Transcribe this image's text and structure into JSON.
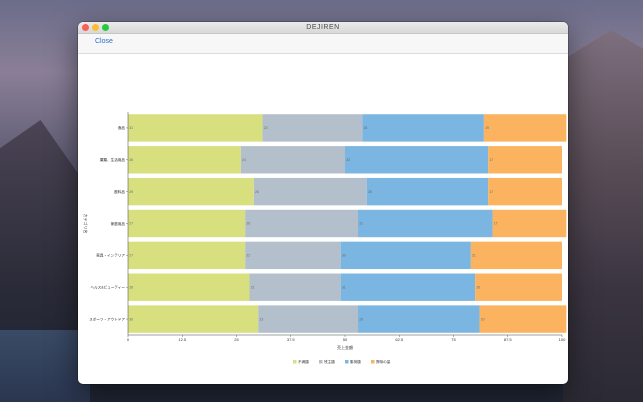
{
  "window": {
    "title": "DEJIREN"
  },
  "toolbar": {
    "close_label": "Close"
  },
  "chart_data": {
    "type": "bar",
    "orientation": "horizontal",
    "stacked": true,
    "categories": [
      "食品",
      "菓類、生活用品",
      "飲料品",
      "家庭用品",
      "家具・インテリア",
      "ヘルス&ビューティー",
      "スポーツ・アウトドア"
    ],
    "series": [
      {
        "name": "不満額",
        "color": "#d8df7e",
        "values": [
          31,
          26,
          29,
          27,
          27,
          28,
          30
        ]
      },
      {
        "name": "残主額",
        "color": "#b3c0cc",
        "values": [
          23,
          24,
          26,
          26,
          22,
          21,
          23
        ]
      },
      {
        "name": "集荷額",
        "color": "#7ab6e1",
        "values": [
          28,
          33,
          28,
          31,
          30,
          31,
          28
        ]
      },
      {
        "name": "興味の量",
        "color": "#fbb360",
        "values": [
          19,
          17,
          17,
          17,
          21,
          20,
          20
        ]
      }
    ],
    "xlabel": "売上金額",
    "ylabel": "カテゴリ名",
    "xlim": [
      0,
      100
    ],
    "xticks": [
      "0",
      "12.5",
      "25",
      "37.5",
      "50",
      "62.5",
      "75",
      "87.5",
      "100"
    ],
    "legend": "bottom",
    "grid": false
  }
}
